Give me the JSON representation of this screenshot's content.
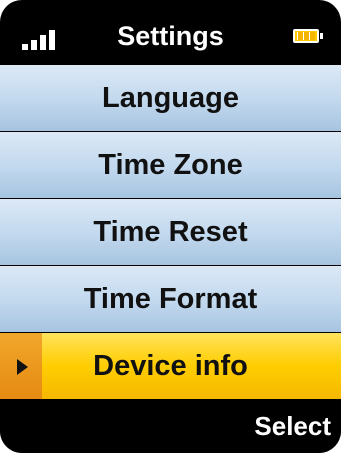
{
  "status_bar": {
    "title": "Settings",
    "signal_icon": "signal-strength-icon",
    "battery_icon": "battery-icon",
    "battery_color": "#ffcc00"
  },
  "menu": {
    "items": [
      {
        "label": "Language",
        "selected": false
      },
      {
        "label": "Time Zone",
        "selected": false
      },
      {
        "label": "Time Reset",
        "selected": false
      },
      {
        "label": "Time Format",
        "selected": false
      },
      {
        "label": "Device info",
        "selected": true
      }
    ],
    "item_color": "#c1d8ee",
    "selected_color": "#ffcd00",
    "selector_icon": "selection-arrow-icon"
  },
  "softkeys": {
    "right_label": "Select"
  }
}
